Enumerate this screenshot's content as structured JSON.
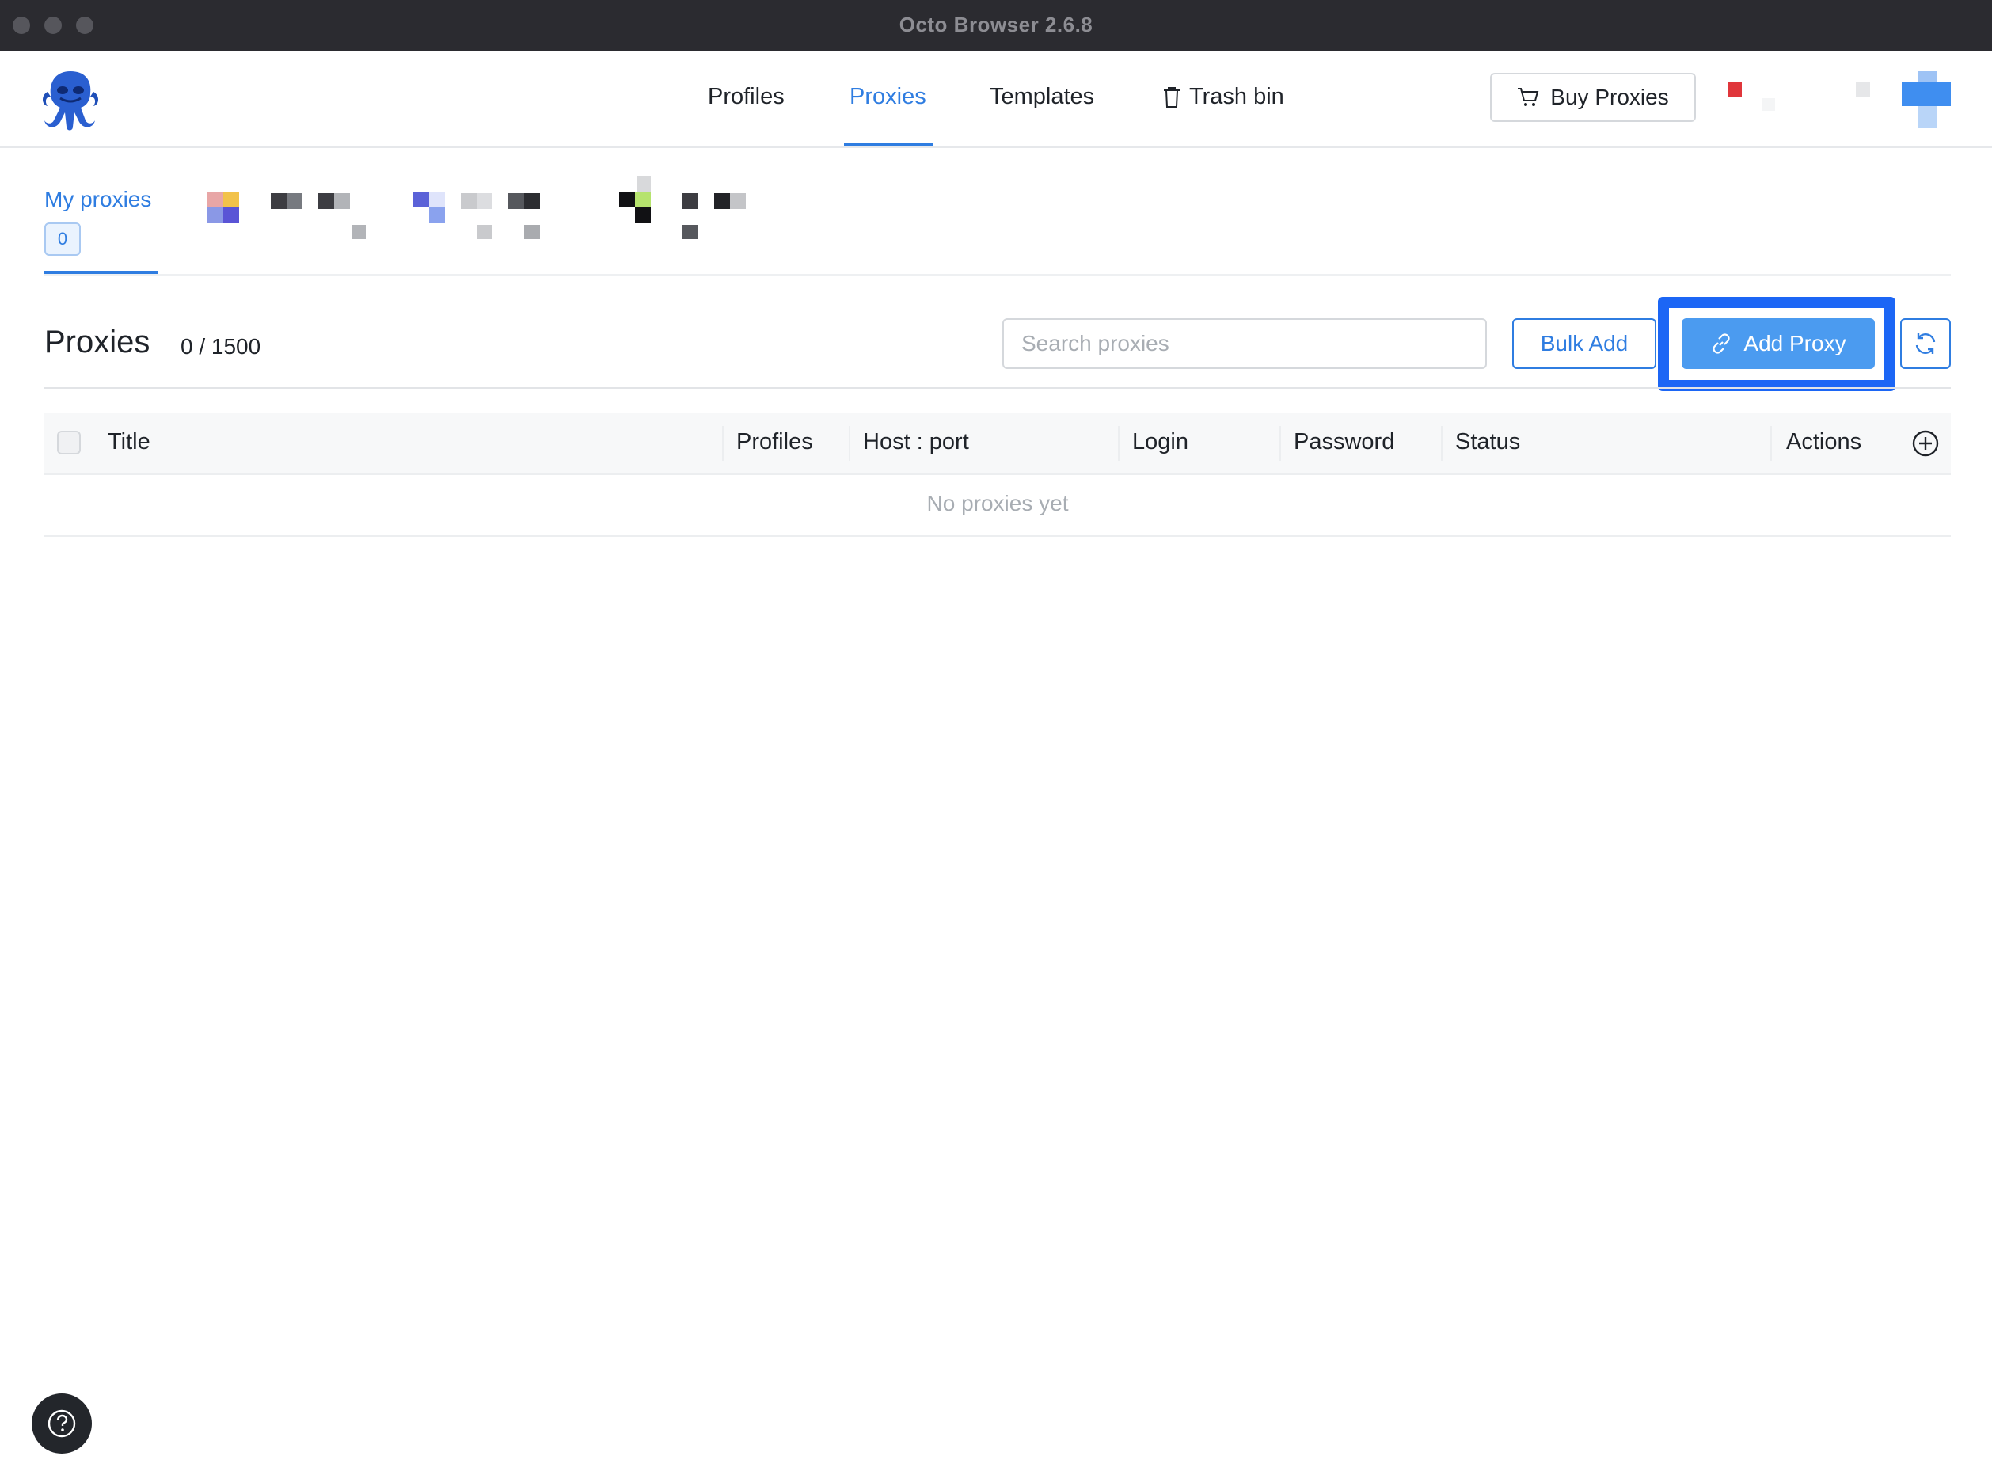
{
  "window": {
    "title": "Octo Browser 2.6.8"
  },
  "nav": {
    "items": [
      {
        "label": "Profiles"
      },
      {
        "label": "Proxies",
        "active": true
      },
      {
        "label": "Templates"
      },
      {
        "label": "Trash bin",
        "icon": "trash-icon"
      }
    ],
    "buy_proxies": {
      "label": "Buy Proxies",
      "icon": "cart-icon"
    }
  },
  "subtabs": {
    "active": {
      "label": "My proxies",
      "count": "0"
    }
  },
  "toolbar": {
    "title": "Proxies",
    "counter": "0 / 1500",
    "search_placeholder": "Search proxies",
    "bulk_add_label": "Bulk Add",
    "add_proxy_label": "Add Proxy",
    "add_proxy_icon": "link-icon",
    "refresh_icon": "refresh-icon"
  },
  "table": {
    "columns": [
      "Title",
      "Profiles",
      "Host : port",
      "Login",
      "Password",
      "Status",
      "Actions"
    ],
    "empty_text": "No proxies yet",
    "add_column_icon": "plus-circle-icon"
  },
  "help": {
    "icon": "question-circle-icon"
  },
  "colors": {
    "accent": "#2f7de1",
    "add_button": "#4b9bf0",
    "highlight": "#1c66f5",
    "titlebar": "#2b2b30"
  }
}
